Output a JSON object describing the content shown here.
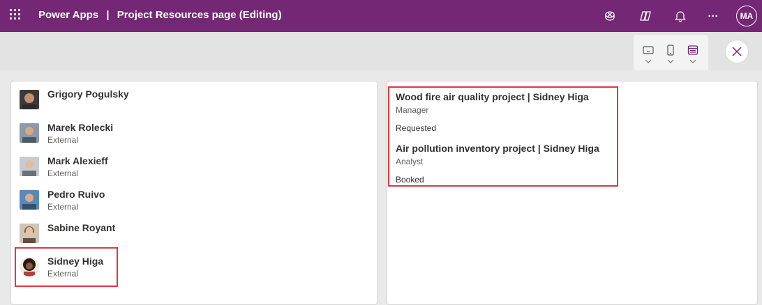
{
  "header": {
    "app_name": "Power Apps",
    "separator": "|",
    "page_title": "Project Resources page (Editing)",
    "user_initials": "MA",
    "more_label": "···",
    "icons": [
      "waffle-icon",
      "environment-icon",
      "copilot-icon",
      "bell-icon",
      "more-icon"
    ]
  },
  "toolbar": {
    "device_icons": [
      "tablet-icon",
      "phone-icon",
      "web-layout-icon"
    ],
    "close_icon": "close-icon"
  },
  "people": [
    {
      "name": "Grigory Pogulsky",
      "type": ""
    },
    {
      "name": "Marek Rolecki",
      "type": "External"
    },
    {
      "name": "Mark Alexieff",
      "type": "External"
    },
    {
      "name": "Pedro Ruivo",
      "type": "External"
    },
    {
      "name": "Sabine Royant",
      "type": ""
    },
    {
      "name": "Sidney Higa",
      "type": "External"
    }
  ],
  "projects": [
    {
      "title": "Wood fire air quality project | Sidney Higa",
      "role": "Manager",
      "status": "Requested"
    },
    {
      "title": "Air pollution inventory project | Sidney Higa",
      "role": "Analyst",
      "status": "Booked"
    }
  ],
  "colors": {
    "header_bg": "#742774",
    "highlight": "#e0383e",
    "accent": "#742774"
  }
}
